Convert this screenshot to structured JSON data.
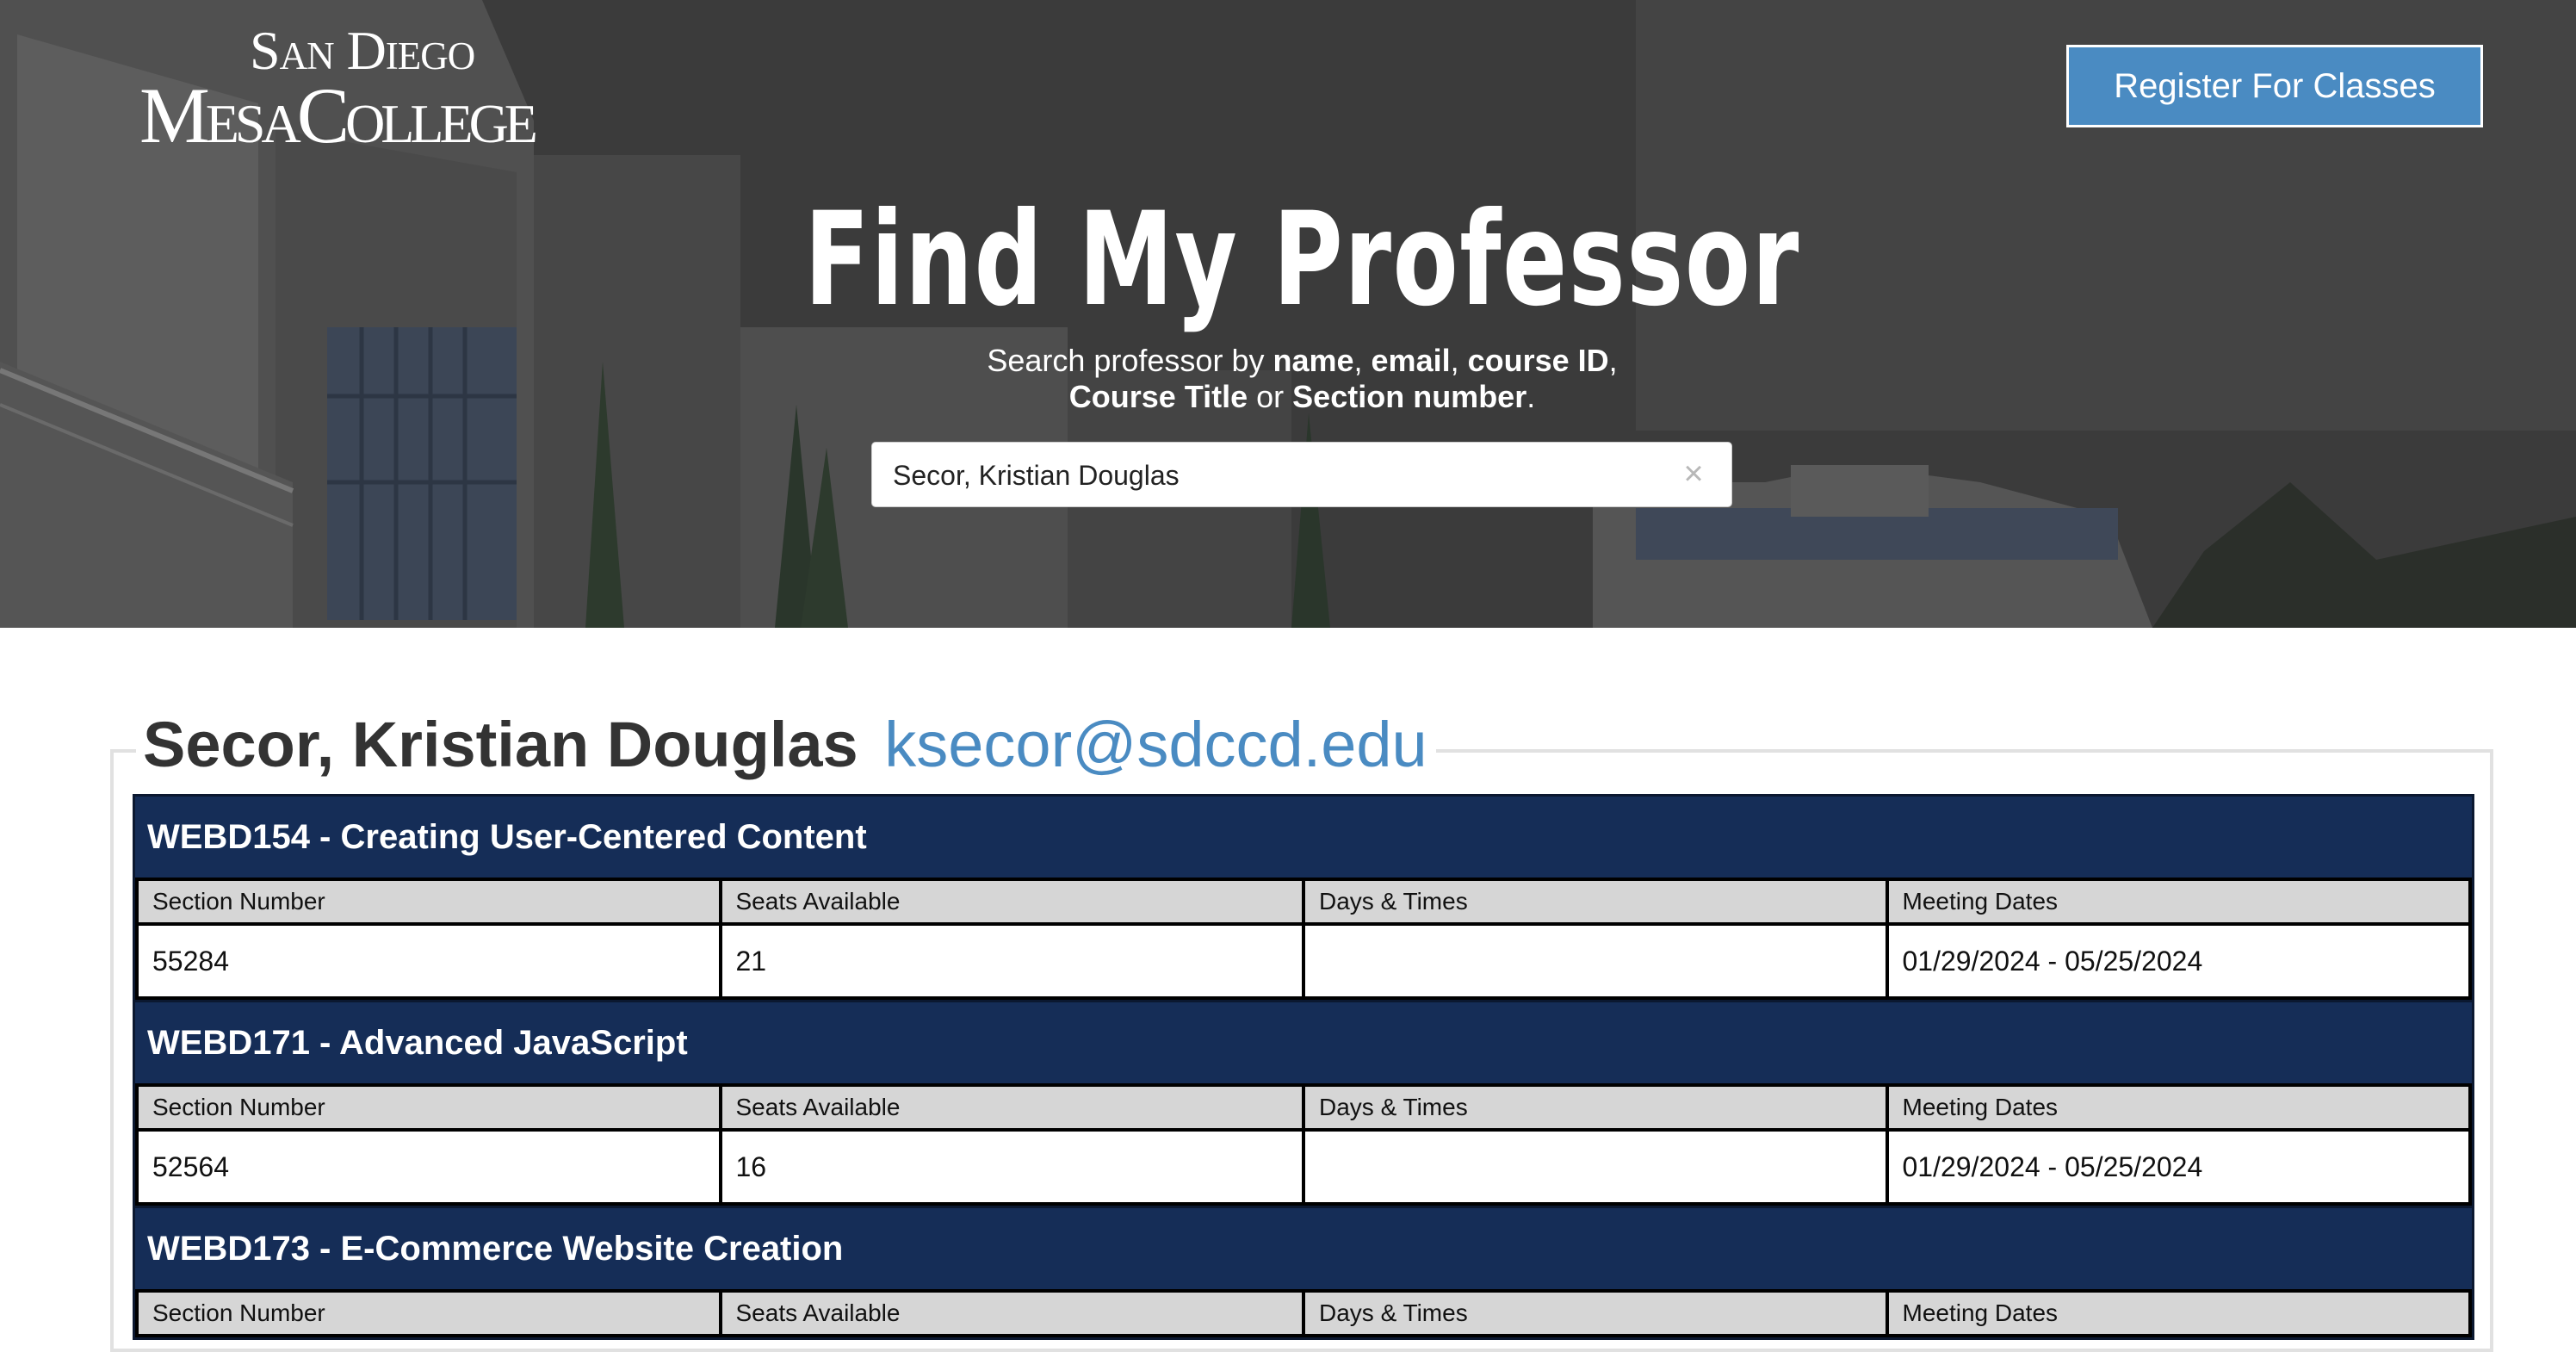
{
  "header": {
    "logo_line1": "San Diego",
    "logo_line2": "MesaCollege",
    "register_label": "Register For Classes",
    "title": "Find My Professor",
    "subtitle": {
      "p1": "Search professor by ",
      "b1": "name",
      "p2": ", ",
      "b2": "email",
      "p3": ", ",
      "b3": "course ID",
      "p4": ",",
      "b4": "Course Title",
      "p5": " or ",
      "b5": "Section number",
      "p6": "."
    }
  },
  "search": {
    "value": "Secor, Kristian Douglas",
    "clear_icon": "×"
  },
  "professor": {
    "name": "Secor, Kristian Douglas",
    "email": "ksecor@sdccd.edu"
  },
  "table_headers": [
    "Section Number",
    "Seats Available",
    "Days & Times",
    "Meeting Dates"
  ],
  "courses": [
    {
      "title": "WEBD154 - Creating User-Centered Content",
      "section": "55284",
      "seats": "21",
      "days_times": "",
      "dates": "01/29/2024 - 05/25/2024"
    },
    {
      "title": "WEBD171 - Advanced JavaScript",
      "section": "52564",
      "seats": "16",
      "days_times": "",
      "dates": "01/29/2024 - 05/25/2024"
    },
    {
      "title": "WEBD173 - E-Commerce Website Creation",
      "section": "",
      "seats": "",
      "days_times": "",
      "dates": ""
    }
  ],
  "colors": {
    "accent": "#4a8bc2",
    "course_header": "#152d57",
    "table_header": "#d6d6d6"
  }
}
